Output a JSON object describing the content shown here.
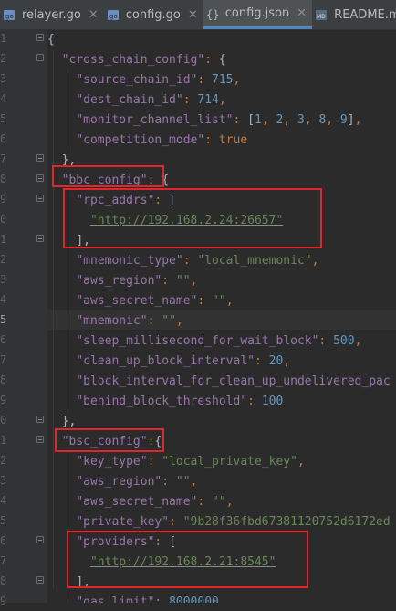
{
  "tabs": [
    {
      "label": "relayer.go",
      "icon": "go-file-icon",
      "active": false
    },
    {
      "label": "config.go",
      "icon": "go-file-icon",
      "active": false
    },
    {
      "label": "config.json",
      "icon": "json-file-icon",
      "active": true
    },
    {
      "label": "README.md",
      "icon": "markdown-file-icon",
      "active": false
    }
  ],
  "gutter": {
    "line_numbers": [
      "1",
      "2",
      "3",
      "4",
      "5",
      "6",
      "7",
      "8",
      "9",
      "0",
      "1",
      "2",
      "3",
      "4",
      "5",
      "6",
      "7",
      "8",
      "9",
      "0",
      "1",
      "2",
      "3",
      "4",
      "5",
      "6",
      "7",
      "8",
      "9",
      "0"
    ]
  },
  "code": {
    "l1": "{",
    "l2_key": "\"cross_chain_config\"",
    "l3_key": "\"source_chain_id\"",
    "l3_val": "715",
    "l4_key": "\"dest_chain_id\"",
    "l4_val": "714",
    "l5_key": "\"monitor_channel_list\"",
    "l5_v1": "1",
    "l5_v2": "2",
    "l5_v3": "3",
    "l5_v4": "8",
    "l5_v5": "9",
    "l6_key": "\"competition_mode\"",
    "l6_val": "true",
    "l7": "},",
    "l8_key": "\"bbc_config\"",
    "l9_key": "\"rpc_addrs\"",
    "l10_val": "\"http://192.168.2.24:26657\"",
    "l11": "],",
    "l12_key": "\"mnemonic_type\"",
    "l12_val": "\"local_mnemonic\"",
    "l13_key": "\"aws_region\"",
    "l13_val": "\"\"",
    "l14_key": "\"aws_secret_name\"",
    "l14_val": "\"\"",
    "l15_key": "\"mnemonic\"",
    "l15_val": "\"\"",
    "l16_key": "\"sleep_millisecond_for_wait_block\"",
    "l16_val": "500",
    "l17_key": "\"clean_up_block_interval\"",
    "l17_val": "20",
    "l18_key": "\"block_interval_for_clean_up_undelivered_pac",
    "l19_key": "\"behind_block_threshold\"",
    "l19_val": "100",
    "l20": "},",
    "l21_key": "\"bsc_config\"",
    "l22_key": "\"key_type\"",
    "l22_val": "\"local_private_key\"",
    "l23_key": "\"aws_region\"",
    "l23_val": "\"\"",
    "l24_key": "\"aws_secret_name\"",
    "l24_val": "\"\"",
    "l25_key": "\"private_key\"",
    "l25_val": "\"9b28f36fbd67381120752d6172ed",
    "l26_key": "\"providers\"",
    "l27_val": "\"http://192.168.2.21:8545\"",
    "l28": "],",
    "l29_key": "\"gas_limit\"",
    "l29_val": "8000000"
  },
  "colors": {
    "background": "#2b2b2b",
    "gutter": "#313335",
    "key": "#9876aa",
    "string": "#6a8759",
    "number": "#6897bb",
    "keyword": "#cc7832",
    "highlight_box": "#e0262b",
    "active_tab_underline": "#4a88c7"
  }
}
